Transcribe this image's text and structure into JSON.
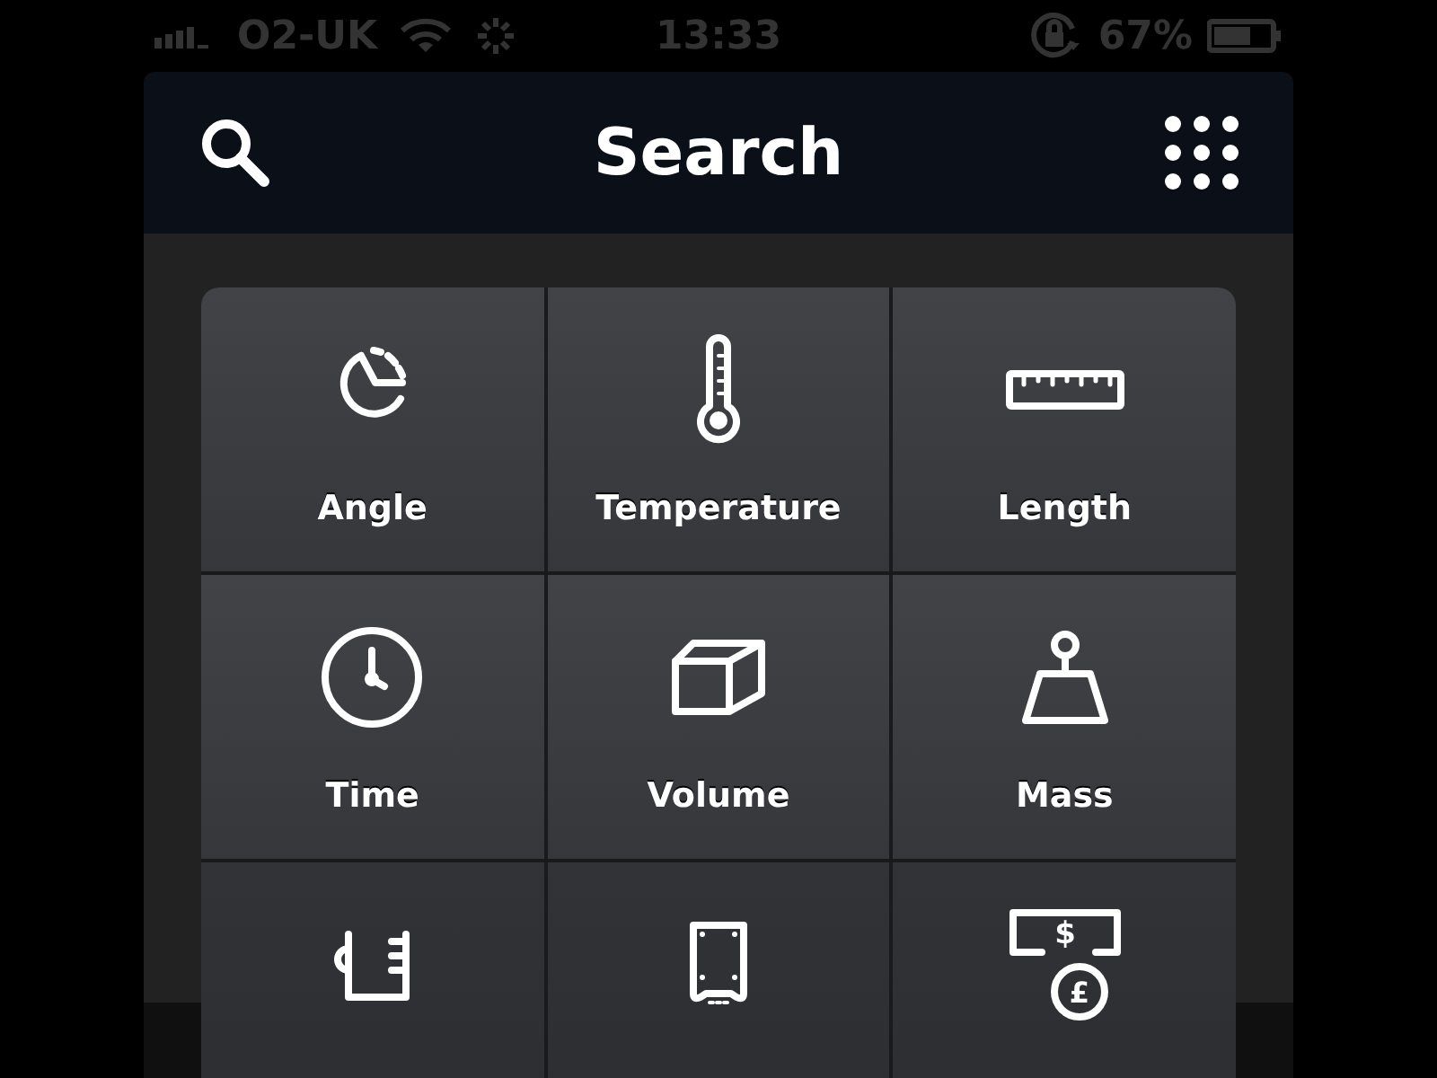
{
  "status_bar": {
    "carrier": "O2-UK",
    "time": "13:33",
    "battery": "67%"
  },
  "header": {
    "title": "Search"
  },
  "tiles": [
    {
      "kind": "angle",
      "label": "Angle"
    },
    {
      "kind": "temperature",
      "label": "Temperature"
    },
    {
      "kind": "length",
      "label": "Length"
    },
    {
      "kind": "time",
      "label": "Time"
    },
    {
      "kind": "volume",
      "label": "Volume"
    },
    {
      "kind": "mass",
      "label": "Mass"
    },
    {
      "kind": "liquid"
    },
    {
      "kind": "storage"
    },
    {
      "kind": "currency",
      "symbols": [
        "$",
        "£"
      ]
    }
  ]
}
